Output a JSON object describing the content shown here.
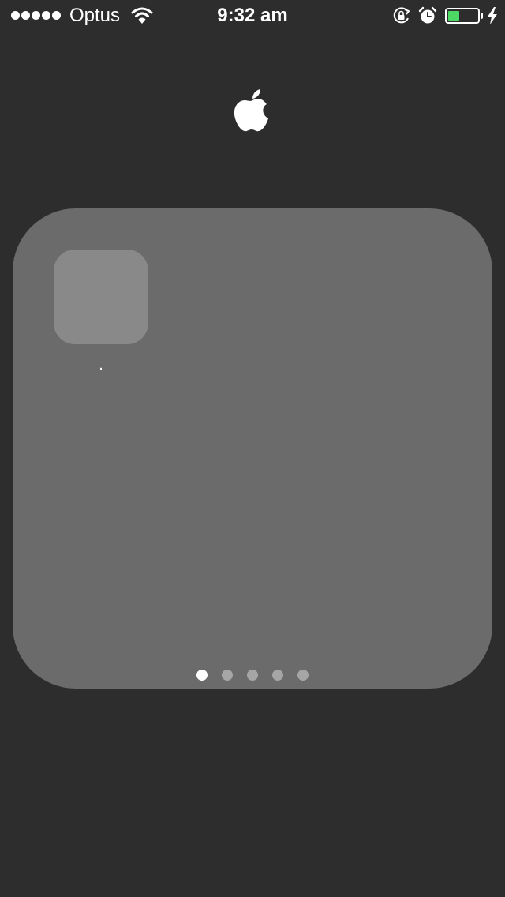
{
  "status_bar": {
    "signal_bars_filled": 5,
    "signal_bars_total": 5,
    "carrier": "Optus",
    "time": "9:32 am",
    "battery_level_fraction": 0.38,
    "charging": true,
    "icons": [
      "wifi-icon",
      "rotation-lock-icon",
      "alarm-icon",
      "battery-icon",
      "charging-bolt-icon"
    ],
    "battery_color": "#4cd964"
  },
  "logo": {
    "icon": "apple-logo-icon"
  },
  "folder": {
    "background_color": "#6b6b6b",
    "app_slots": [
      {
        "label": "."
      }
    ],
    "pages_total": 5,
    "current_page": 1
  },
  "colors": {
    "background": "#2d2d2d",
    "page_dot_active": "#ffffff",
    "page_dot_inactive": "#a6a6a6"
  }
}
